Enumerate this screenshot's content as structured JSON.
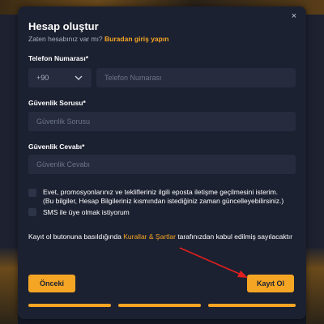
{
  "modal": {
    "title": "Hesap oluştur",
    "close_glyph": "×",
    "subtitle_prefix": "Zaten hesabınız var mı?",
    "login_link": "Buradan giriş yapın"
  },
  "phone": {
    "label": "Telefon Numarası*",
    "country_code": "+90",
    "placeholder": "Telefon Numarası"
  },
  "security_question": {
    "label": "Güvenlik Sorusu*",
    "placeholder": "Güvenlik Sorusu"
  },
  "security_answer": {
    "label": "Güvenlik Cevabı*",
    "placeholder": "Güvenlik Cevabı"
  },
  "consent": {
    "email_line1": "Evet, promosyonlarınız ve teklifleriniz ilgili eposta iletişme geçilmesini isterim.",
    "email_line2": "(Bu bilgiler, Hesap Bilgileriniz kısmından istediğiniz zaman güncelleyebilirsiniz.)",
    "sms": "SMS ile üye olmak istiyorum"
  },
  "terms": {
    "prefix": "Kayıt ol butonuna basıldığında",
    "link": "Kurallar & Şartlar",
    "suffix": "tarafınızdan kabul edilmiş sayılacaktır"
  },
  "buttons": {
    "previous": "Önceki",
    "register": "Kayıt Ol"
  },
  "colors": {
    "accent": "#f5a524",
    "modal_bg": "#1c2131",
    "field_bg": "#262c3e",
    "annotation_arrow": "#e01f1f"
  },
  "icons": {
    "close": "close-icon",
    "dropdown": "chevron-down-icon",
    "annotation": "red-arrow-annotation"
  }
}
